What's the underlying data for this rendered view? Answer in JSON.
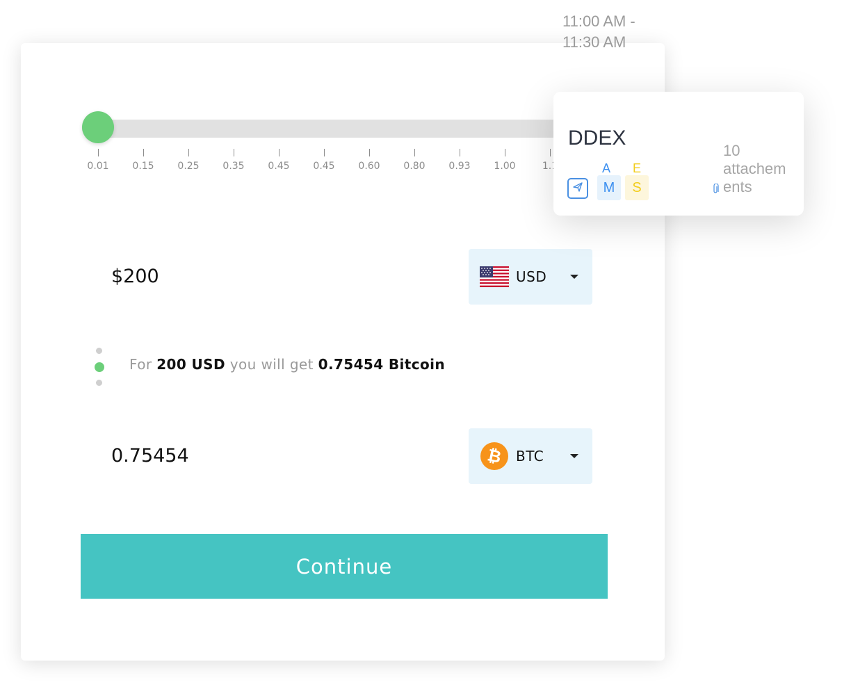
{
  "slider": {
    "ticks": [
      "0.01",
      "0.15",
      "0.25",
      "0.35",
      "0.45",
      "0.45",
      "0.60",
      "0.80",
      "0.93",
      "1.00",
      "1.1"
    ],
    "value_index": 0,
    "colors": {
      "thumb": "#6ccf7a",
      "track": "#e1e1e1"
    }
  },
  "from": {
    "amount": "$200",
    "currency_code": "USD",
    "flag_icon": "us-flag-icon"
  },
  "rate": {
    "prefix": "For",
    "from_value": "200 USD",
    "middle": "you will get",
    "to_value": "0.75454 Bitcoin"
  },
  "to": {
    "amount": "0.75454",
    "currency_code": "BTC",
    "coin_icon": "bitcoin-icon"
  },
  "continue_label": "Continue",
  "event": {
    "time_start": "11:00 AM -",
    "time_end": "11:30 AM",
    "title": "DDEX",
    "avatars": [
      {
        "small": "A",
        "big": "M",
        "color": "#3b8ff0",
        "bg": "#e6f2fc"
      },
      {
        "small": "E",
        "big": "S",
        "color": "#f2cd1c",
        "bg": "#fdf6dc"
      }
    ],
    "attachments_lines": [
      "10",
      "attachem",
      "ents"
    ]
  },
  "colors": {
    "accent": "#45c4c2",
    "currency_bg": "#e7f4fb",
    "bitcoin": "#f7931a"
  }
}
